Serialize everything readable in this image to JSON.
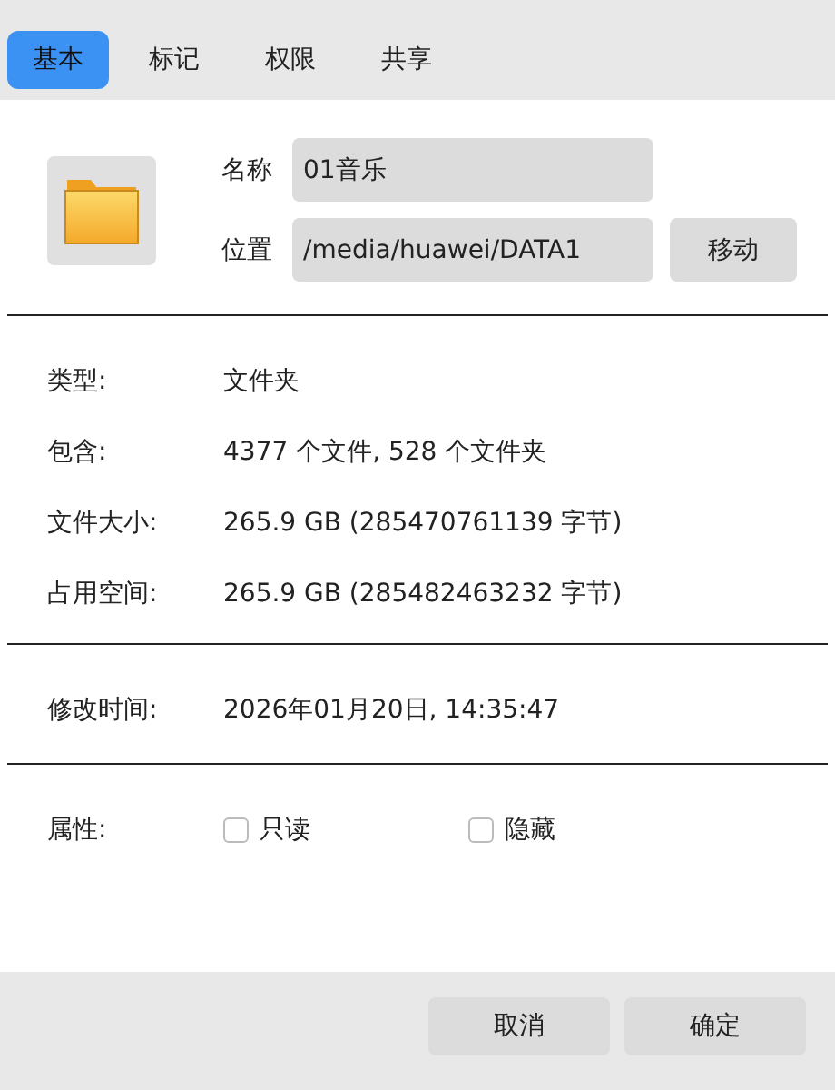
{
  "tabs": [
    {
      "label": "基本",
      "selected": true
    },
    {
      "label": "标记",
      "selected": false
    },
    {
      "label": "权限",
      "selected": false
    },
    {
      "label": "共享",
      "selected": false
    }
  ],
  "name_field": {
    "label": "名称",
    "value": "01音乐"
  },
  "location_field": {
    "label": "位置",
    "value": "/media/huawei/DATA1",
    "button": "移动"
  },
  "info_rows": [
    {
      "label": "类型:",
      "value": "文件夹"
    },
    {
      "label": "包含:",
      "value": "4377 个文件, 528 个文件夹"
    },
    {
      "label": "文件大小:",
      "value": "265.9 GB (285470761139 字节)"
    },
    {
      "label": "占用空间:",
      "value": "265.9 GB (285482463232 字节)"
    }
  ],
  "modified": {
    "label": "修改时间:",
    "value": "2026年01月20日, 14:35:47"
  },
  "attributes": {
    "label": "属性:",
    "options": [
      {
        "label": "只读",
        "checked": false
      },
      {
        "label": "隐藏",
        "checked": false
      }
    ]
  },
  "buttons": [
    "取消",
    "确定"
  ]
}
